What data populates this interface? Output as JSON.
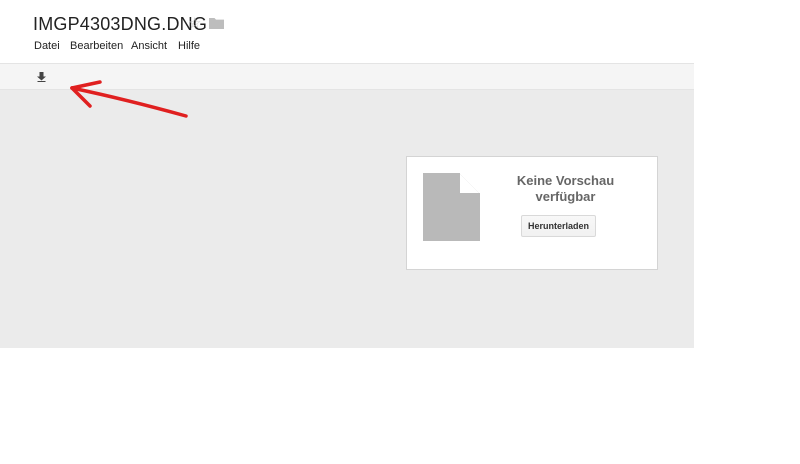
{
  "document": {
    "title": "IMGP4303DNG.DNG",
    "star_icon": "star-outline-icon",
    "folder_icon": "folder-icon"
  },
  "menu": {
    "items": [
      "Datei",
      "Bearbeiten",
      "Ansicht",
      "Hilfe"
    ]
  },
  "toolbar": {
    "download_icon": "download-arrow-icon"
  },
  "preview": {
    "message_line1": "Keine Vorschau",
    "message_line2": "verfügbar",
    "download_label": "Herunterladen",
    "file_icon": "generic-file-icon"
  },
  "annotation": {
    "arrow_color": "#e02020"
  },
  "colors": {
    "viewer_background": "#ebebeb",
    "toolbar_background": "#f5f5f5",
    "file_icon_gray": "#b9b9b9"
  }
}
